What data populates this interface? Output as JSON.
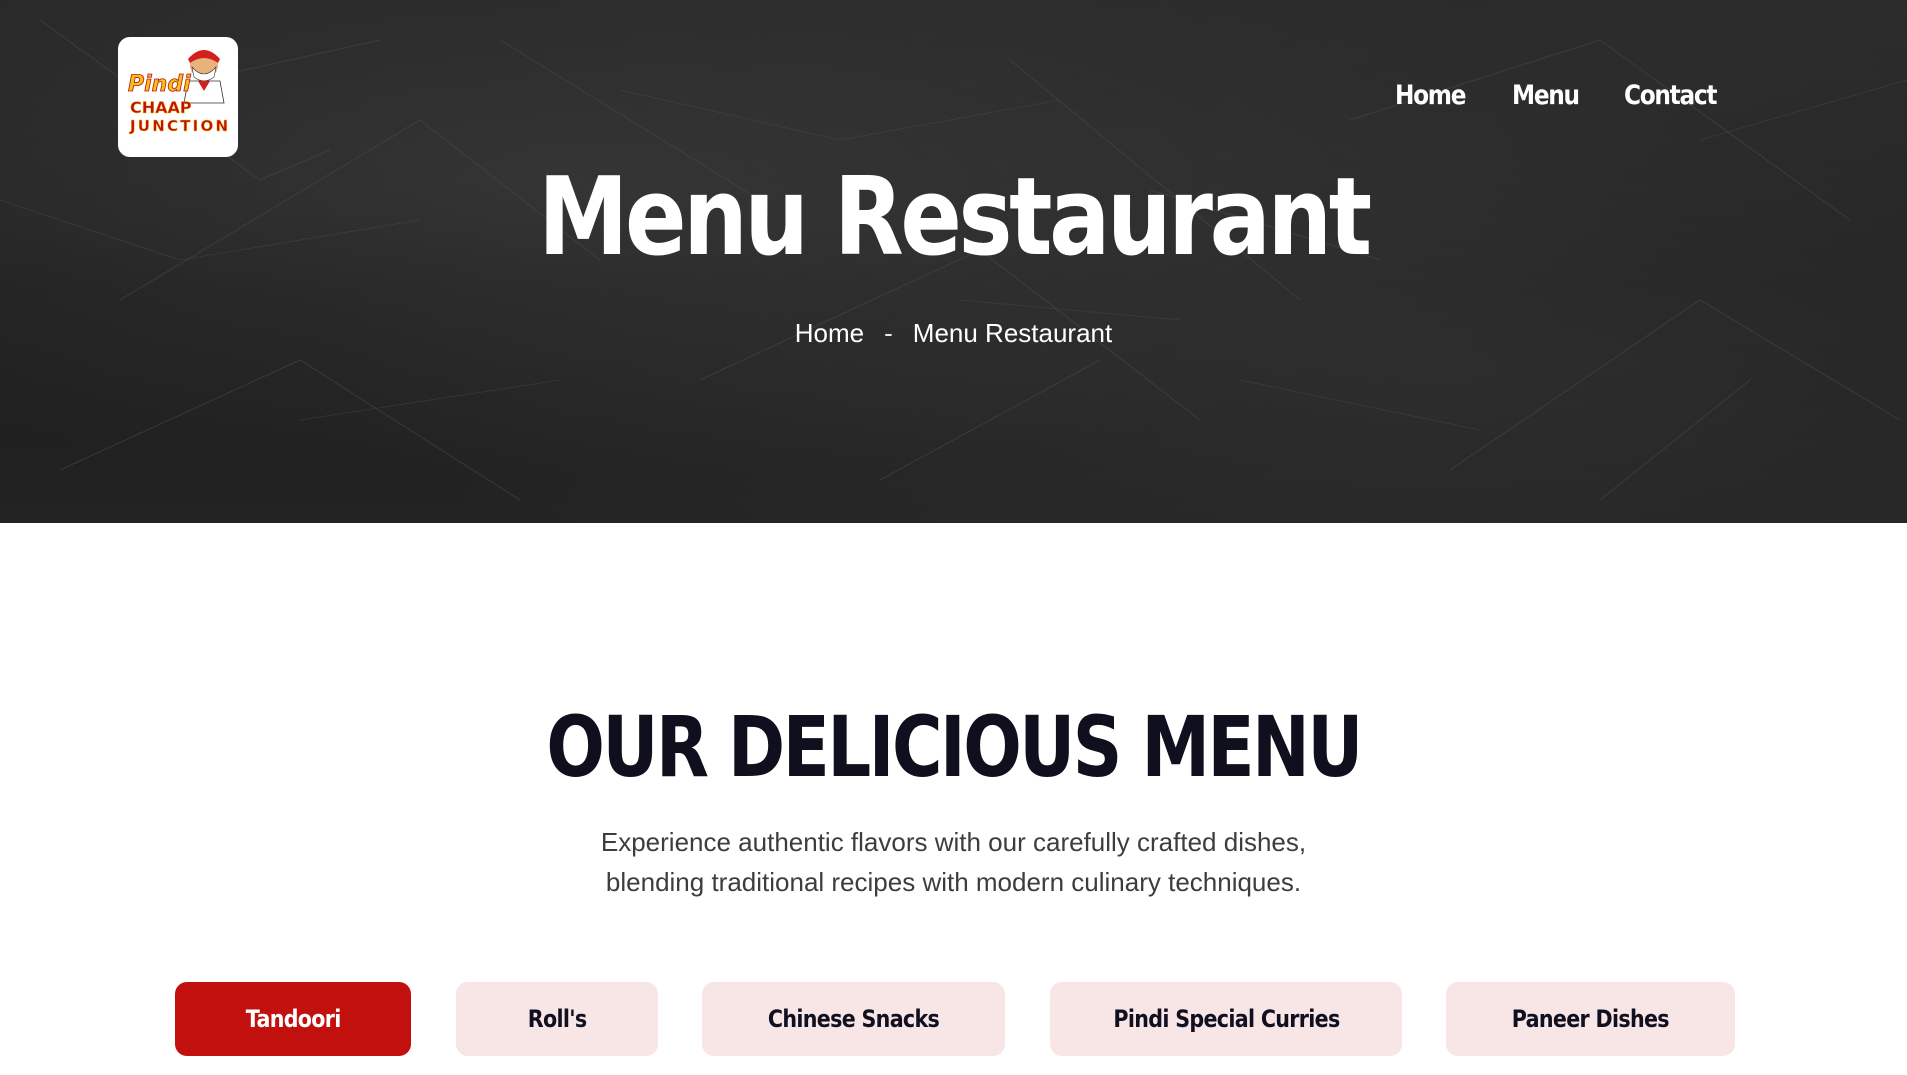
{
  "colors": {
    "hero_bg": "#232323",
    "accent": "#c1100d",
    "tab_bg": "#f8e5e5",
    "heading": "#0f0f1e",
    "text": "#3d3d3d"
  },
  "header": {
    "logo_text": {
      "line1": "Pindi",
      "line2": "CHAAP",
      "line3": "JUNCTION"
    },
    "nav": [
      {
        "label": "Home"
      },
      {
        "label": "Menu"
      },
      {
        "label": "Contact"
      }
    ]
  },
  "hero": {
    "title": "Menu Restaurant",
    "breadcrumb": {
      "home": "Home",
      "separator": "-",
      "current": "Menu Restaurant"
    }
  },
  "menu_section": {
    "title": "OUR DELICIOUS MENU",
    "description_line1": "Experience authentic flavors with our carefully crafted dishes,",
    "description_line2": "blending traditional recipes with modern culinary techniques.",
    "tabs": [
      {
        "label": "Tandoori",
        "active": true
      },
      {
        "label": "Roll's",
        "active": false
      },
      {
        "label": "Chinese Snacks",
        "active": false
      },
      {
        "label": "Pindi Special Curries",
        "active": false
      },
      {
        "label": "Paneer Dishes",
        "active": false
      }
    ]
  }
}
